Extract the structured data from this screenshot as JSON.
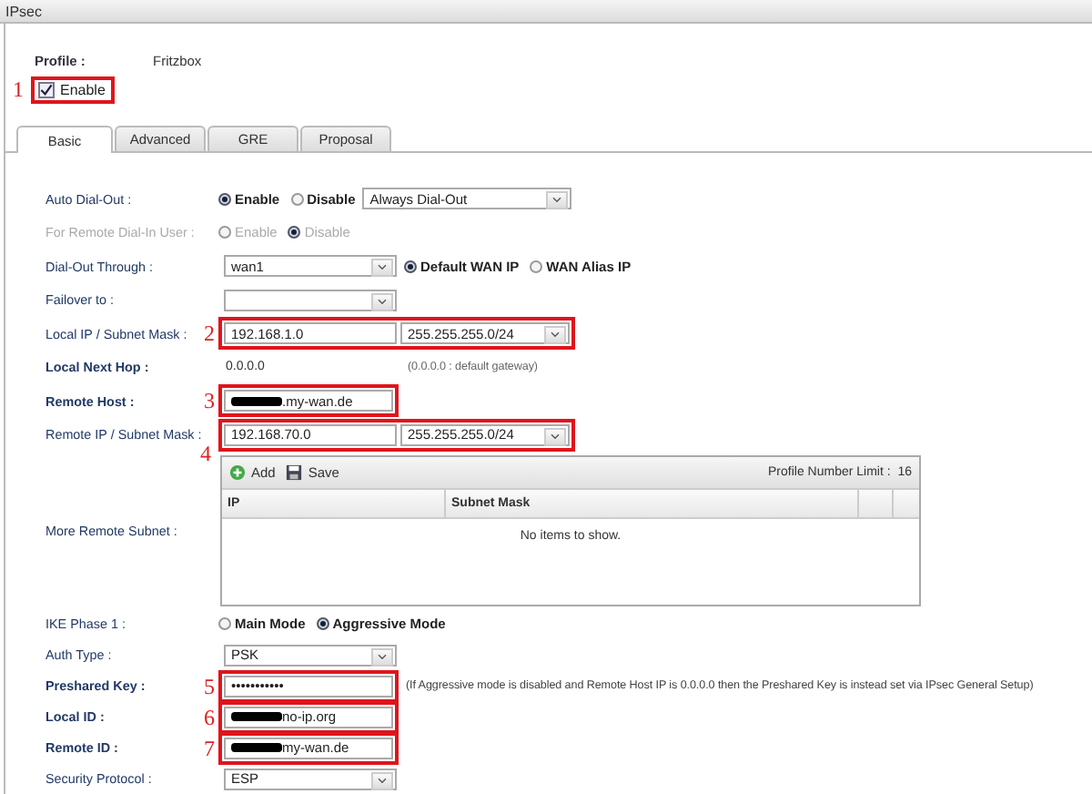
{
  "window": {
    "title": "IPsec"
  },
  "profile": {
    "label": "Profile :",
    "value": "Fritzbox"
  },
  "enable": {
    "label": "Enable",
    "checked": true,
    "annotation": "1"
  },
  "tabs": [
    {
      "label": "Basic",
      "selected": true
    },
    {
      "label": "Advanced",
      "selected": false
    },
    {
      "label": "GRE",
      "selected": false
    },
    {
      "label": "Proposal",
      "selected": false
    }
  ],
  "rows": [
    {
      "kind": "radio_select",
      "label": "Auto Dial-Out :",
      "bold": false,
      "disabled": false,
      "options": [
        {
          "label": "Enable",
          "selected": true
        },
        {
          "label": "Disable",
          "selected": false
        }
      ],
      "select": "Always Dial-Out"
    },
    {
      "kind": "radio",
      "label": "For Remote Dial-In User :",
      "bold": false,
      "disabled": true,
      "options": [
        {
          "label": "Enable",
          "selected": false
        },
        {
          "label": "Disable",
          "selected": true
        }
      ]
    },
    {
      "kind": "select_radio",
      "label": "Dial-Out Through :",
      "bold": false,
      "disabled": false,
      "select": "wan1",
      "options": [
        {
          "label": "Default WAN IP",
          "selected": true
        },
        {
          "label": "WAN Alias IP",
          "selected": false
        }
      ]
    },
    {
      "kind": "select",
      "label": "Failover to :",
      "bold": false,
      "disabled": false
    },
    {
      "kind": "ip_mask",
      "label": "Local IP / Subnet Mask :",
      "bold": false,
      "disabled": false,
      "annotation": "2",
      "ip": "192.168.1.0",
      "mask": "255.255.255.0/24"
    },
    {
      "kind": "text",
      "label": "Local Next Hop :",
      "bold": true,
      "disabled": false,
      "value": "0.0.0.0",
      "note": "(0.0.0.0 : default gateway)"
    },
    {
      "kind": "input",
      "label": "Remote Host :",
      "bold": true,
      "disabled": false,
      "annotation": "3",
      "redacted": true,
      "value": ".my-wan.de"
    },
    {
      "kind": "ip_mask",
      "label": "Remote IP / Subnet Mask :",
      "bold": false,
      "disabled": false,
      "annotation": "4",
      "ip": "192.168.70.0",
      "mask": "255.255.255.0/24"
    },
    {
      "kind": "table",
      "label": "More Remote Subnet :",
      "bold": false,
      "disabled": false,
      "add": "Add",
      "save": "Save",
      "limit_label": "Profile Number Limit :",
      "limit": "16",
      "columns": [
        "IP",
        "Subnet Mask"
      ],
      "empty": "No items to show."
    },
    {
      "kind": "radio",
      "label": "IKE Phase 1 :",
      "bold": false,
      "disabled": false,
      "options": [
        {
          "label": "Main Mode",
          "selected": false
        },
        {
          "label": "Aggressive Mode",
          "selected": true
        }
      ]
    },
    {
      "kind": "select",
      "label": "Auth Type :",
      "bold": false,
      "disabled": false,
      "select": "PSK"
    },
    {
      "kind": "input",
      "label": "Preshared Key :",
      "bold": true,
      "disabled": false,
      "annotation": "5",
      "redacted": false,
      "value": "•••••••••••",
      "note": "(If Aggressive mode is disabled and Remote Host IP is 0.0.0.0 then the Preshared Key is instead set via IPsec General Setup)"
    },
    {
      "kind": "input",
      "label": "Local ID :",
      "bold": true,
      "disabled": false,
      "annotation": "6",
      "redacted": true,
      "value": "no-ip.org"
    },
    {
      "kind": "input",
      "label": "Remote ID :",
      "bold": true,
      "disabled": false,
      "annotation": "7",
      "redacted": true,
      "value": "my-wan.de"
    },
    {
      "kind": "select",
      "label": "Security Protocol :",
      "bold": false,
      "disabled": false,
      "select": "ESP"
    }
  ]
}
